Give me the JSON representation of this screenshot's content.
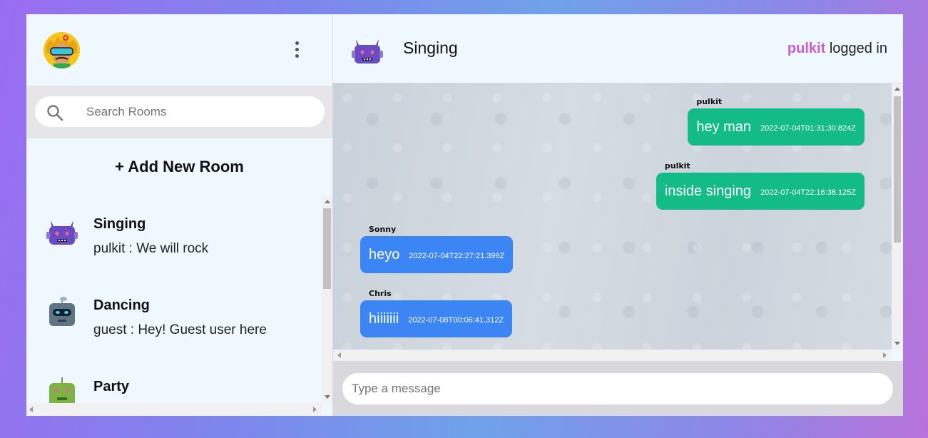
{
  "sidebar": {
    "user_avatar_icon": "user-avatar-sunglasses",
    "menu_icon": "more-vertical-icon",
    "search": {
      "placeholder": "Search Rooms",
      "icon": "search-icon"
    },
    "add_room_label": "+ Add New Room",
    "rooms": [
      {
        "name": "Singing",
        "last_message": "pulkit : We will rock",
        "avatar_icon": "purple-robot-icon"
      },
      {
        "name": "Dancing",
        "last_message": "guest : Hey! Guest user here",
        "avatar_icon": "gray-robot-icon"
      },
      {
        "name": "Party",
        "last_message": "",
        "avatar_icon": "green-robot-icon"
      }
    ]
  },
  "chat": {
    "room_name": "Singing",
    "room_avatar_icon": "purple-robot-icon",
    "logged_in_user": "pulkit",
    "logged_in_suffix": "logged in",
    "messages": [
      {
        "sender": "pulkit",
        "text": "hey man",
        "timestamp": "2022-07-04T01:31:30.824Z",
        "own": true
      },
      {
        "sender": "pulkit",
        "text": "inside singing",
        "timestamp": "2022-07-04T22:16:38.125Z",
        "own": true
      },
      {
        "sender": "Sonny",
        "text": "heyo",
        "timestamp": "2022-07-04T22:27:21.399Z",
        "own": false
      },
      {
        "sender": "Chris",
        "text": "hiiiiiii",
        "timestamp": "2022-07-08T00:06:41.312Z",
        "own": false
      }
    ],
    "composer": {
      "placeholder": "Type a message"
    }
  },
  "colors": {
    "own_bubble": "#13bb86",
    "other_bubble": "#3b85f5",
    "username_accent": "#c95dd1",
    "panel_bg": "#f0f8ff"
  }
}
